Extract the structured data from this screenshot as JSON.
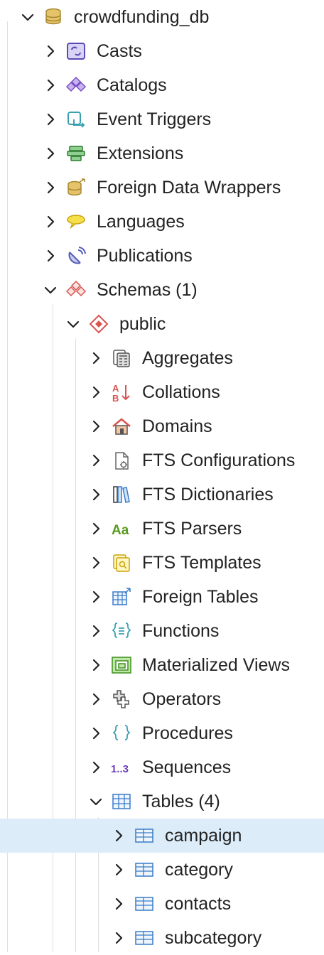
{
  "tree": {
    "database": {
      "label": "crowdfunding_db",
      "expanded": true,
      "icon": "database-icon"
    },
    "db_children": [
      {
        "label": "Casts",
        "icon": "casts-icon"
      },
      {
        "label": "Catalogs",
        "icon": "catalogs-icon"
      },
      {
        "label": "Event Triggers",
        "icon": "event-triggers-icon"
      },
      {
        "label": "Extensions",
        "icon": "extensions-icon"
      },
      {
        "label": "Foreign Data Wrappers",
        "icon": "foreign-data-wrappers-icon"
      },
      {
        "label": "Languages",
        "icon": "languages-icon"
      },
      {
        "label": "Publications",
        "icon": "publications-icon"
      },
      {
        "label": "Schemas (1)",
        "icon": "schemas-icon",
        "expanded": true
      }
    ],
    "schema": {
      "label": "public",
      "expanded": true,
      "icon": "schema-icon"
    },
    "schema_children": [
      {
        "label": "Aggregates",
        "icon": "aggregates-icon"
      },
      {
        "label": "Collations",
        "icon": "collations-icon"
      },
      {
        "label": "Domains",
        "icon": "domains-icon"
      },
      {
        "label": "FTS Configurations",
        "icon": "fts-configurations-icon"
      },
      {
        "label": "FTS Dictionaries",
        "icon": "fts-dictionaries-icon"
      },
      {
        "label": "FTS Parsers",
        "icon": "fts-parsers-icon",
        "icon_text": "Aa"
      },
      {
        "label": "FTS Templates",
        "icon": "fts-templates-icon"
      },
      {
        "label": "Foreign Tables",
        "icon": "foreign-tables-icon"
      },
      {
        "label": "Functions",
        "icon": "functions-icon"
      },
      {
        "label": "Materialized Views",
        "icon": "materialized-views-icon"
      },
      {
        "label": "Operators",
        "icon": "operators-icon"
      },
      {
        "label": "Procedures",
        "icon": "procedures-icon"
      },
      {
        "label": "Sequences",
        "icon": "sequences-icon",
        "icon_text": "1..3"
      },
      {
        "label": "Tables (4)",
        "icon": "tables-icon",
        "expanded": true
      }
    ],
    "tables": [
      {
        "label": "campaign",
        "icon": "table-icon",
        "selected": true
      },
      {
        "label": "category",
        "icon": "table-icon"
      },
      {
        "label": "contacts",
        "icon": "table-icon"
      },
      {
        "label": "subcategory",
        "icon": "table-icon"
      }
    ]
  },
  "colors": {
    "selected_row": "#dcecf8",
    "guide_line": "#dedede",
    "text": "#222222"
  }
}
